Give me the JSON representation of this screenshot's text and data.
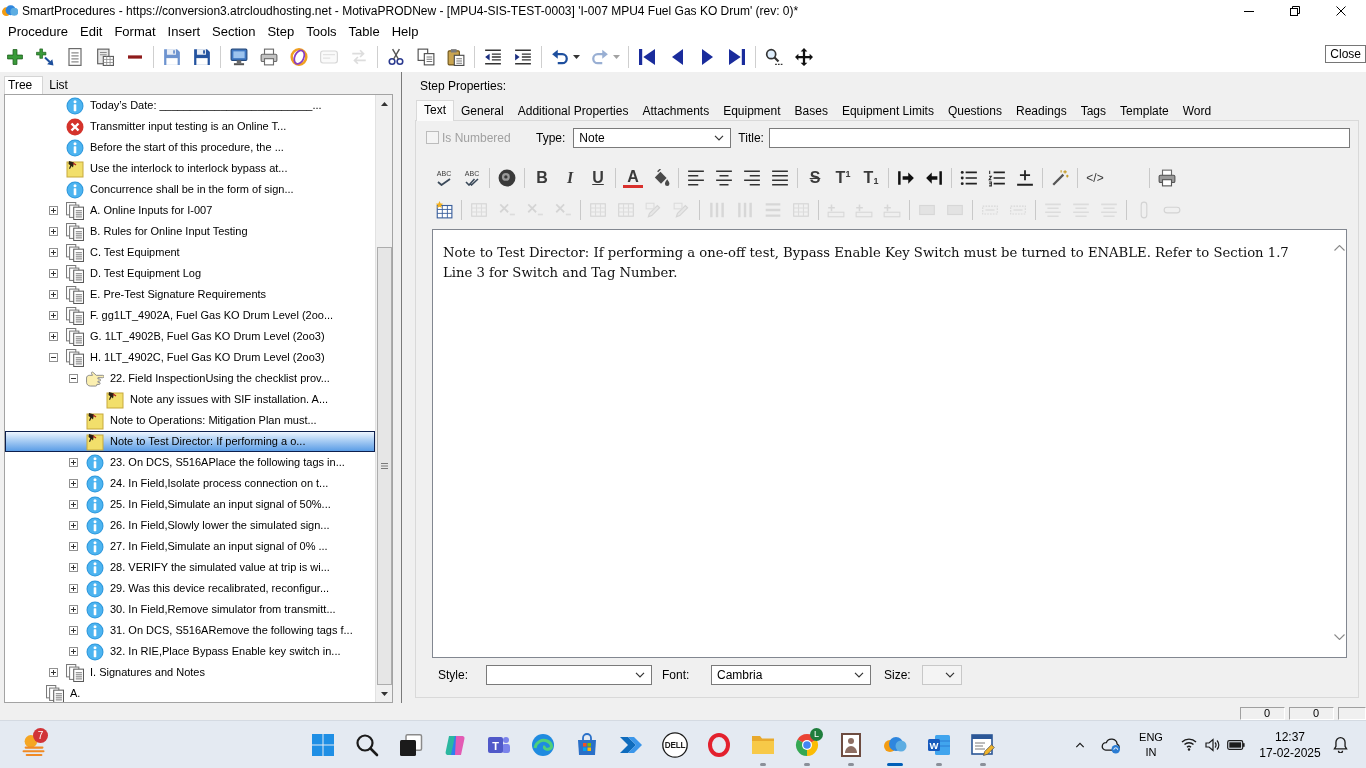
{
  "window": {
    "title": "SmartProcedures - https://conversion3.atrcloudhosting.net - MotivaPRODNew - [MPU4-SIS-TEST-0003] 'I-007 MPU4 Fuel Gas KO Drum' (rev: 0)*"
  },
  "menu": [
    "Procedure",
    "Edit",
    "Format",
    "Insert",
    "Section",
    "Step",
    "Tools",
    "Table",
    "Help"
  ],
  "toolbar": {
    "groups": [
      [
        {
          "kind": "add",
          "disabled": false
        },
        {
          "kind": "add-child",
          "disabled": false
        },
        {
          "kind": "page-lines",
          "disabled": false
        },
        {
          "kind": "page-table",
          "disabled": false
        },
        {
          "kind": "remove",
          "disabled": false
        }
      ],
      [
        {
          "kind": "save-all",
          "disabled": false
        },
        {
          "kind": "save",
          "disabled": false
        }
      ],
      [
        {
          "kind": "monitor",
          "disabled": false
        },
        {
          "kind": "printer",
          "disabled": false
        },
        {
          "kind": "ring",
          "disabled": false
        },
        {
          "kind": "envelope",
          "disabled": true
        },
        {
          "kind": "arrows",
          "disabled": true
        }
      ],
      [
        {
          "kind": "cut",
          "disabled": false
        },
        {
          "kind": "copy",
          "disabled": false
        },
        {
          "kind": "paste",
          "disabled": false
        }
      ],
      [
        {
          "kind": "outdent",
          "disabled": false
        },
        {
          "kind": "indent",
          "disabled": false
        }
      ],
      [
        {
          "kind": "undo",
          "disabled": false,
          "dropdown": true
        },
        {
          "kind": "redo",
          "disabled": true,
          "dropdown": true
        }
      ],
      [
        {
          "kind": "first",
          "disabled": false
        },
        {
          "kind": "previous",
          "disabled": false
        },
        {
          "kind": "next",
          "disabled": false
        },
        {
          "kind": "last",
          "disabled": false
        }
      ],
      [
        {
          "kind": "find",
          "disabled": false
        },
        {
          "kind": "move",
          "disabled": false
        }
      ]
    ]
  },
  "tooltip": {
    "text": "Close"
  },
  "left_panel": {
    "tabs": [
      {
        "label": "Tree",
        "selected": true
      },
      {
        "label": "List",
        "selected": false
      }
    ],
    "tree": [
      {
        "children": [
          {
            "label": "Today’s Date: _________________________...",
            "kind": "info",
            "selected": false
          },
          {
            "label": "Transmitter input testing is an Online T...",
            "kind": "error",
            "selected": false
          },
          {
            "label": "Before the start of this procedure, the ...",
            "kind": "info",
            "selected": false
          },
          {
            "label": "Use the interlock to interlock bypass at...",
            "kind": "note",
            "selected": false
          },
          {
            "label": "Concurrence shall be in the form of sign...",
            "kind": "info",
            "selected": false
          },
          {
            "label": "A. Online Inputs for I-007",
            "kind": "section",
            "expanded": false,
            "selected": false
          },
          {
            "label": "B. Rules for Online Input Testing",
            "kind": "section",
            "expanded": false,
            "selected": false
          },
          {
            "label": "C. Test Equipment",
            "kind": "section",
            "expanded": false,
            "selected": false
          },
          {
            "label": "D. Test Equipment Log",
            "kind": "section",
            "expanded": false,
            "selected": false
          },
          {
            "label": "E. Pre-Test Signature Requirements",
            "kind": "section",
            "expanded": false,
            "selected": false
          },
          {
            "label": "F. gg1LT_4902A, Fuel Gas KO Drum Level (2oo...",
            "kind": "section",
            "expanded": false,
            "selected": false
          },
          {
            "label": "G. 1LT_4902B, Fuel Gas KO Drum Level (2oo3)",
            "kind": "section",
            "expanded": false,
            "selected": false
          },
          {
            "label": "H. 1LT_4902C, Fuel Gas KO Drum Level (2oo3)",
            "kind": "section",
            "expanded": true,
            "selected": false,
            "children": [
              {
                "label": "22. Field InspectionUsing the checklist prov...",
                "kind": "hand",
                "expanded": true,
                "selected": false,
                "children": [
                  {
                    "label": "Note any issues with SIF installation. A...",
                    "kind": "note",
                    "selected": false
                  }
                ]
              },
              {
                "label": "Note to Operations: Mitigation Plan must...",
                "kind": "note",
                "selected": false
              },
              {
                "label": "Note to Test Director: If performing a o...",
                "kind": "note",
                "selected": true
              },
              {
                "label": "23. On DCS, S516APlace the following tags in...",
                "kind": "info",
                "expanded": false,
                "selected": false
              },
              {
                "label": "24. In Field,Isolate process connection on t...",
                "kind": "info",
                "expanded": false,
                "selected": false
              },
              {
                "label": "25. In Field,Simulate an input signal of 50%...",
                "kind": "info",
                "expanded": false,
                "selected": false
              },
              {
                "label": "26. In Field,Slowly lower the simulated sign...",
                "kind": "info",
                "expanded": false,
                "selected": false
              },
              {
                "label": "27. In Field,Simulate an input signal of 0% ...",
                "kind": "info",
                "expanded": false,
                "selected": false
              },
              {
                "label": "28. VERIFY the simulated value at trip is wi...",
                "kind": "info",
                "expanded": false,
                "selected": false
              },
              {
                "label": "29. Was this device recalibrated, reconfigur...",
                "kind": "info",
                "expanded": false,
                "selected": false
              },
              {
                "label": "30. In Field,Remove simulator from transmitt...",
                "kind": "info",
                "expanded": false,
                "selected": false
              },
              {
                "label": "31. On DCS, S516ARemove the following tags f...",
                "kind": "info",
                "expanded": false,
                "selected": false
              },
              {
                "label": "32. In RIE,Place Bypass Enable key switch in...",
                "kind": "info",
                "expanded": false,
                "selected": false
              }
            ]
          },
          {
            "label": "I. Signatures and Notes",
            "kind": "section",
            "expanded": false,
            "selected": false
          }
        ]
      },
      {
        "label": "A.",
        "kind": "section",
        "selected": false
      }
    ]
  },
  "step_properties": {
    "heading": "Step Properties:",
    "tabs": [
      {
        "label": "Text",
        "selected": true
      },
      {
        "label": "General",
        "selected": false
      },
      {
        "label": "Additional Properties",
        "selected": false
      },
      {
        "label": "Attachments",
        "selected": false
      },
      {
        "label": "Equipment",
        "selected": false
      },
      {
        "label": "Bases",
        "selected": false
      },
      {
        "label": "Equipment Limits",
        "selected": false
      },
      {
        "label": "Questions",
        "selected": false
      },
      {
        "label": "Readings",
        "selected": false
      },
      {
        "label": "Tags",
        "selected": false
      },
      {
        "label": "Template",
        "selected": false
      },
      {
        "label": "Word",
        "selected": false
      }
    ],
    "is_numbered": {
      "label": "Is Numbered",
      "checked": false,
      "disabled": true
    },
    "type": {
      "label": "Type:",
      "value": "Note"
    },
    "title": {
      "label": "Title:"
    },
    "format_toolbar": {
      "rows": [
        [
          [
            {
              "kind": "spellcheck",
              "glyph": "ABC",
              "disabled": false
            },
            {
              "kind": "spellcheck-all",
              "glyph": "ABC",
              "disabled": false
            }
          ],
          [
            {
              "kind": "disc",
              "disabled": false
            }
          ],
          [
            {
              "kind": "bold",
              "glyph": "B",
              "disabled": false
            },
            {
              "kind": "italic",
              "glyph": "I",
              "disabled": false
            },
            {
              "kind": "underline",
              "glyph": "U",
              "disabled": false
            }
          ],
          [
            {
              "kind": "font-color",
              "glyph": "A",
              "disabled": false
            },
            {
              "kind": "fill",
              "disabled": false
            }
          ],
          [
            {
              "kind": "align-left",
              "disabled": false
            },
            {
              "kind": "align-center",
              "disabled": false
            },
            {
              "kind": "align-right",
              "disabled": false
            },
            {
              "kind": "justify",
              "disabled": false
            }
          ],
          [
            {
              "kind": "strike",
              "glyph": "S",
              "disabled": false
            },
            {
              "kind": "superscript",
              "glyph": "T$^{1}$",
              "disabled": false
            },
            {
              "kind": "subscript",
              "glyph": "T$_{1}$",
              "disabled": false
            }
          ],
          [
            {
              "kind": "indent",
              "disabled": false
            },
            {
              "kind": "outdent",
              "disabled": false
            }
          ],
          [
            {
              "kind": "bullets",
              "disabled": false
            },
            {
              "kind": "numbering",
              "disabled": false
            },
            {
              "kind": "rule",
              "disabled": false
            }
          ],
          [
            {
              "kind": "wand",
              "disabled": false
            }
          ],
          [
            {
              "kind": "html",
              "glyph": "</>",
              "disabled": false
            }
          ],
          [
            {
              "kind": "print",
              "disabled": false
            }
          ]
        ],
        [
          [
            {
              "kind": "table-insert",
              "disabled": false
            }
          ],
          [
            {
              "kind": "grid",
              "disabled": true
            },
            {
              "kind": "x-mark",
              "disabled": true
            },
            {
              "kind": "x-mark",
              "disabled": true
            },
            {
              "kind": "x-mark",
              "disabled": true
            }
          ],
          [
            {
              "kind": "grid",
              "disabled": true
            },
            {
              "kind": "grid",
              "disabled": true
            },
            {
              "kind": "pencil",
              "disabled": true
            },
            {
              "kind": "pencil",
              "disabled": true
            }
          ],
          [
            {
              "kind": "columns",
              "disabled": true
            },
            {
              "kind": "columns",
              "disabled": true
            },
            {
              "kind": "rows",
              "disabled": true
            },
            {
              "kind": "grid",
              "disabled": true
            }
          ],
          [
            {
              "kind": "row-insert",
              "disabled": true
            },
            {
              "kind": "row-insert",
              "disabled": true
            },
            {
              "kind": "row-insert",
              "disabled": true
            }
          ],
          [
            {
              "kind": "block",
              "disabled": true
            },
            {
              "kind": "block",
              "disabled": true
            }
          ],
          [
            {
              "kind": "dotted",
              "disabled": true
            },
            {
              "kind": "dotted",
              "disabled": true
            }
          ],
          [
            {
              "kind": "lines",
              "disabled": true
            },
            {
              "kind": "lines",
              "disabled": true
            },
            {
              "kind": "lines",
              "disabled": true
            }
          ],
          [
            {
              "kind": "pill-v",
              "disabled": true
            },
            {
              "kind": "pill-h",
              "disabled": true
            }
          ]
        ]
      ]
    },
    "editor": {
      "text": "Note to Test Director: If performing a one-off test, Bypass Enable Key Switch must be turned to ENABLE. Refer to Section 1.7 Line 3 for Switch and Tag Number."
    },
    "style": {
      "label": "Style:"
    },
    "font": {
      "label": "Font:",
      "value": "Cambria"
    },
    "size": {
      "label": "Size:",
      "disabled": true
    }
  },
  "status_bar": {
    "panels": [
      "0",
      "0"
    ]
  },
  "taskbar": {
    "widget_badge": "7",
    "apps": [
      {
        "kind": "start",
        "running": false,
        "active": false
      },
      {
        "kind": "search",
        "running": false,
        "active": false
      },
      {
        "kind": "task-view",
        "running": false,
        "active": false
      },
      {
        "kind": "copilot",
        "running": false,
        "active": false
      },
      {
        "kind": "teams",
        "glyph": "T",
        "running": false,
        "active": false
      },
      {
        "kind": "edge",
        "running": false,
        "active": false
      },
      {
        "kind": "store",
        "running": false,
        "active": false
      },
      {
        "kind": "flow",
        "running": false,
        "active": false
      },
      {
        "kind": "dell",
        "glyph": "DELL",
        "running": false,
        "active": false
      },
      {
        "kind": "opera",
        "running": false,
        "active": false
      },
      {
        "kind": "folder",
        "running": true,
        "active": false
      },
      {
        "kind": "chrome",
        "badge": "L",
        "running": true,
        "active": false
      },
      {
        "kind": "viewer",
        "running": true,
        "active": false
      },
      {
        "kind": "smartprocedures",
        "running": true,
        "active": true
      },
      {
        "kind": "word",
        "glyph": "W",
        "running": true,
        "active": false
      },
      {
        "kind": "editor",
        "running": true,
        "active": false
      }
    ],
    "tray": {
      "language": "ENG",
      "region": "IN",
      "time": "12:37",
      "date": "17-02-2025"
    }
  }
}
